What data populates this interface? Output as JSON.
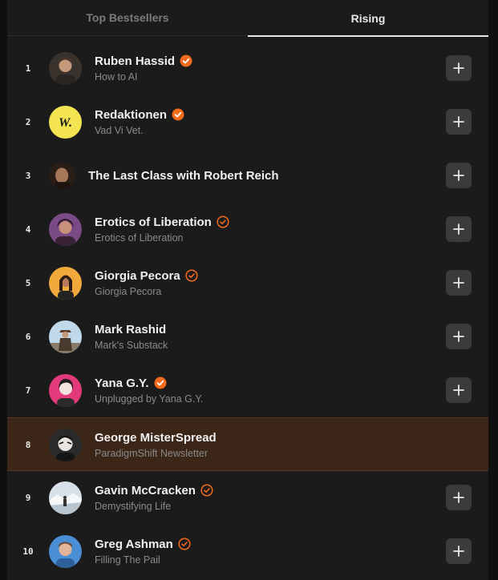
{
  "tabs": {
    "left": "Top Bestsellers",
    "right": "Rising"
  },
  "colors": {
    "accent": "#f26a1b",
    "highlight": "#3b2617"
  },
  "items": [
    {
      "rank": "1",
      "name": "Ruben Hassid",
      "sub": "How to AI"
    },
    {
      "rank": "2",
      "name": "Redaktionen",
      "sub": "Vad Vi Vet."
    },
    {
      "rank": "3",
      "name": "The Last Class with Robert Reich",
      "sub": ""
    },
    {
      "rank": "4",
      "name": "Erotics of Liberation",
      "sub": "Erotics of Liberation"
    },
    {
      "rank": "5",
      "name": "Giorgia Pecora",
      "sub": "Giorgia Pecora"
    },
    {
      "rank": "6",
      "name": "Mark Rashid",
      "sub": "Mark's Substack"
    },
    {
      "rank": "7",
      "name": "Yana G.Y.",
      "sub": "Unplugged by Yana G.Y."
    },
    {
      "rank": "8",
      "name": "George MisterSpread",
      "sub": "ParadigmShift Newsletter"
    },
    {
      "rank": "9",
      "name": "Gavin McCracken",
      "sub": "Demystifying Life"
    },
    {
      "rank": "10",
      "name": "Greg Ashman",
      "sub": "Filling The Pail"
    }
  ],
  "avatar_texts": {
    "redaktionen": "W."
  }
}
